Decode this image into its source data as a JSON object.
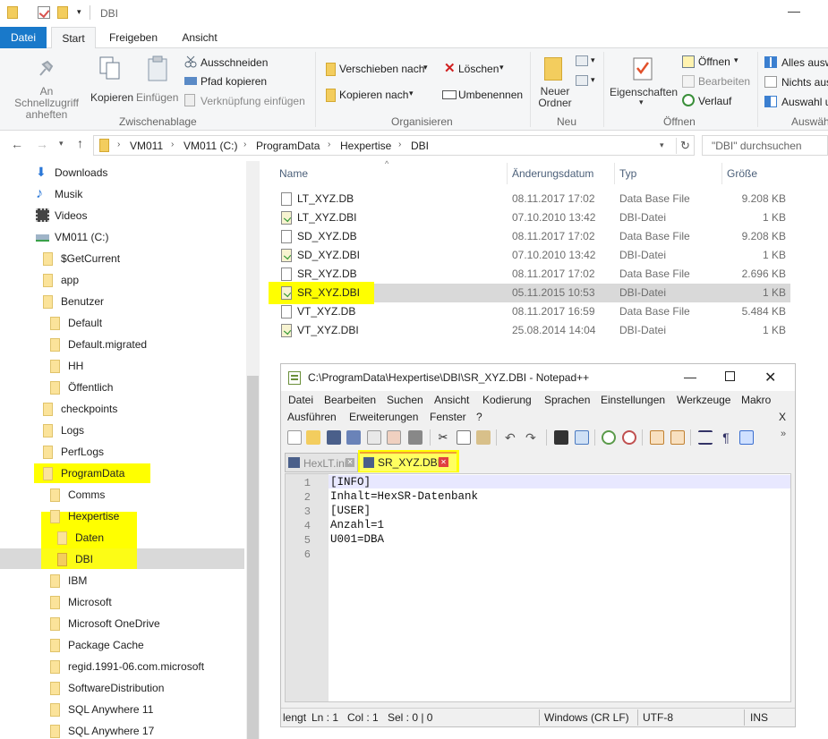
{
  "window": {
    "title": "DBI",
    "minimize": "—"
  },
  "ribbon_tabs": [
    "Datei",
    "Start",
    "Freigeben",
    "Ansicht"
  ],
  "ribbon": {
    "clipboard": {
      "pin": "An Schnellzugriff anheften",
      "copy": "Kopieren",
      "paste": "Einfügen",
      "cut": "Ausschneiden",
      "copy_path": "Pfad kopieren",
      "paste_link": "Verknüpfung einfügen",
      "group": "Zwischenablage"
    },
    "organize": {
      "move": "Verschieben nach",
      "copy_to": "Kopieren nach",
      "delete": "Löschen",
      "rename": "Umbenennen",
      "group": "Organisieren"
    },
    "new": {
      "folder": "Neuer Ordner",
      "group": "Neu"
    },
    "open": {
      "properties": "Eigenschaften",
      "open": "Öffnen",
      "edit": "Bearbeiten",
      "history": "Verlauf",
      "group": "Öffnen"
    },
    "select": {
      "all": "Alles ausw",
      "none": "Nichts aus",
      "invert": "Auswahl u",
      "group": "Auswäh"
    }
  },
  "address": {
    "crumbs": [
      "VM011",
      "VM011 (C:)",
      "ProgramData",
      "Hexpertise",
      "DBI"
    ],
    "search_placeholder": "\"DBI\" durchsuchen"
  },
  "nav": [
    {
      "label": "Downloads",
      "icon": "download-arrow-icon"
    },
    {
      "label": "Musik",
      "icon": "music-note-icon"
    },
    {
      "label": "Videos",
      "icon": "film-strip-icon"
    },
    {
      "label": "VM011 (C:)",
      "icon": "drive-icon"
    },
    {
      "label": "$GetCurrent"
    },
    {
      "label": "app"
    },
    {
      "label": "Benutzer"
    },
    {
      "label": "Default"
    },
    {
      "label": "Default.migrated"
    },
    {
      "label": "HH"
    },
    {
      "label": "Öffentlich"
    },
    {
      "label": "checkpoints"
    },
    {
      "label": "Logs"
    },
    {
      "label": "PerfLogs"
    },
    {
      "label": "ProgramData"
    },
    {
      "label": "Comms"
    },
    {
      "label": "Hexpertise"
    },
    {
      "label": "Daten"
    },
    {
      "label": "DBI"
    },
    {
      "label": "IBM"
    },
    {
      "label": "Microsoft"
    },
    {
      "label": "Microsoft OneDrive"
    },
    {
      "label": "Package Cache"
    },
    {
      "label": "regid.1991-06.com.microsoft"
    },
    {
      "label": "SoftwareDistribution"
    },
    {
      "label": "SQL Anywhere 11"
    },
    {
      "label": "SQL Anywhere 17"
    }
  ],
  "file_columns": {
    "name": "Name",
    "date": "Änderungsdatum",
    "type": "Typ",
    "size": "Größe"
  },
  "files": [
    {
      "name": "LT_XYZ.DB",
      "date": "08.11.2017 17:02",
      "type": "Data Base File",
      "size": "9.208 KB"
    },
    {
      "name": "LT_XYZ.DBI",
      "date": "07.10.2010 13:42",
      "type": "DBI-Datei",
      "size": "1 KB"
    },
    {
      "name": "SD_XYZ.DB",
      "date": "08.11.2017 17:02",
      "type": "Data Base File",
      "size": "9.208 KB"
    },
    {
      "name": "SD_XYZ.DBI",
      "date": "07.10.2010 13:42",
      "type": "DBI-Datei",
      "size": "1 KB"
    },
    {
      "name": "SR_XYZ.DB",
      "date": "08.11.2017 17:02",
      "type": "Data Base File",
      "size": "2.696 KB"
    },
    {
      "name": "SR_XYZ.DBI",
      "date": "05.11.2015 10:53",
      "type": "DBI-Datei",
      "size": "1 KB"
    },
    {
      "name": "VT_XYZ.DB",
      "date": "08.11.2017 16:59",
      "type": "Data Base File",
      "size": "5.484 KB"
    },
    {
      "name": "VT_XYZ.DBI",
      "date": "25.08.2014 14:04",
      "type": "DBI-Datei",
      "size": "1 KB"
    }
  ],
  "npp": {
    "title": "C:\\ProgramData\\Hexpertise\\DBI\\SR_XYZ.DBI - Notepad++",
    "menu1": [
      "Datei",
      "Bearbeiten",
      "Suchen",
      "Ansicht",
      "Kodierung",
      "Sprachen",
      "Einstellungen",
      "Werkzeuge",
      "Makro"
    ],
    "menu2": [
      "Ausführen",
      "Erweiterungen",
      "Fenster",
      "?"
    ],
    "menu_close": "X",
    "tabs": [
      {
        "label": "HexLT.ini"
      },
      {
        "label": "SR_XYZ.DBI"
      }
    ],
    "lines": [
      "[INFO]",
      "Inhalt=HexSR-Datenbank",
      "[USER]",
      "Anzahl=1",
      "U001=DBA",
      ""
    ],
    "line_numbers": [
      "1",
      "2",
      "3",
      "4",
      "5",
      "6"
    ],
    "status": {
      "length": "lengt",
      "ln": "Ln : 1",
      "col": "Col : 1",
      "sel": "Sel : 0 | 0",
      "eol": "Windows (CR LF)",
      "enc": "UTF-8",
      "ins": "INS"
    }
  },
  "colors": {
    "highlight": "#ffff00",
    "accent": "#1979ca",
    "folder": "#f3cd5e"
  }
}
